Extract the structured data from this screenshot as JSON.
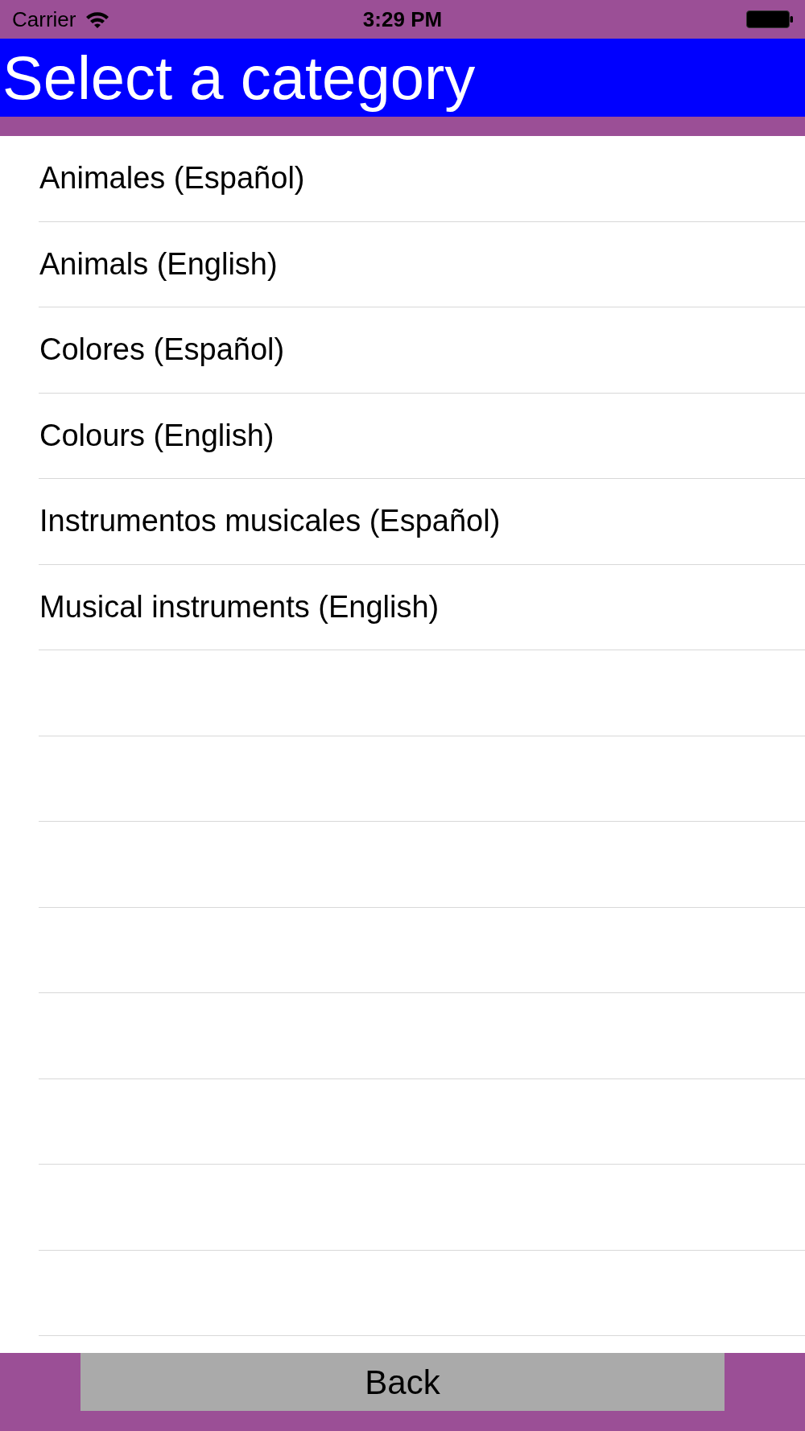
{
  "status_bar": {
    "carrier": "Carrier",
    "time": "3:29 PM"
  },
  "header": {
    "title": "Select a category"
  },
  "categories": [
    {
      "label": "Animales (Español)"
    },
    {
      "label": "Animals (English)"
    },
    {
      "label": "Colores (Español)"
    },
    {
      "label": "Colours (English)"
    },
    {
      "label": "Instrumentos musicales (Español)"
    },
    {
      "label": "Musical instruments (English)"
    }
  ],
  "footer": {
    "back_button": "Back"
  }
}
